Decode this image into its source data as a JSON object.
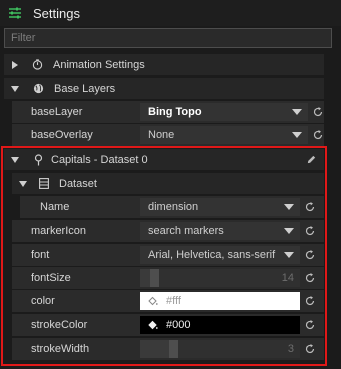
{
  "header": {
    "title": "Settings",
    "icon": "sliders-icon"
  },
  "filter": {
    "placeholder": "Filter"
  },
  "folders": {
    "animation": {
      "label": "Animation Settings",
      "icon": "timer-icon"
    },
    "base_layers": {
      "label": "Base Layers",
      "icon": "globe-icon"
    },
    "capitals": {
      "label": "Capitals - Dataset 0",
      "icon": "pin-icon"
    },
    "dataset": {
      "label": "Dataset",
      "icon": "table-icon"
    }
  },
  "base_layer": {
    "label": "baseLayer",
    "value": "Bing Topo"
  },
  "base_overlay": {
    "label": "baseOverlay",
    "value": "None"
  },
  "name": {
    "label": "Name",
    "value": "dimension"
  },
  "marker_icon": {
    "label": "markerIcon",
    "value": "search markers"
  },
  "font": {
    "label": "font",
    "value": "Arial, Helvetica, sans-serif"
  },
  "font_size": {
    "label": "fontSize",
    "value": "14",
    "level": 0.06
  },
  "color": {
    "label": "color",
    "value": "#fff",
    "swatch": "#ffffff"
  },
  "stroke_color": {
    "label": "strokeColor",
    "value": "#000",
    "swatch": "#000000"
  },
  "stroke_width": {
    "label": "strokeWidth",
    "value": "3",
    "level": 0.18
  },
  "colors": {
    "accent_border": "#e01818",
    "panel": "#2b2b2b",
    "background": "#1b1b1b"
  }
}
